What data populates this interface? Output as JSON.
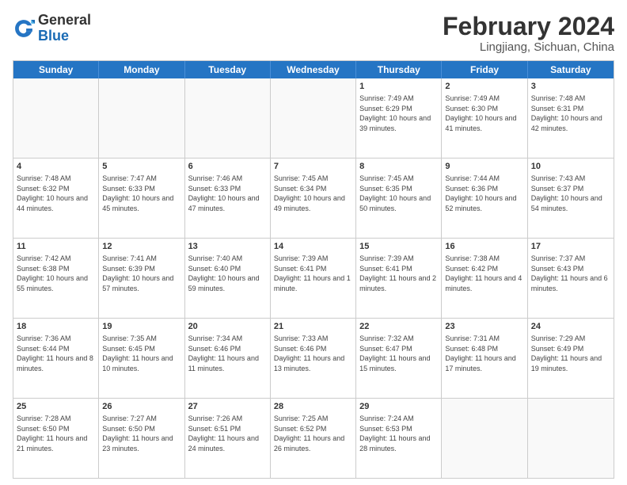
{
  "header": {
    "logo_general": "General",
    "logo_blue": "Blue",
    "month_title": "February 2024",
    "location": "Lingjiang, Sichuan, China"
  },
  "days_of_week": [
    "Sunday",
    "Monday",
    "Tuesday",
    "Wednesday",
    "Thursday",
    "Friday",
    "Saturday"
  ],
  "rows": [
    [
      {
        "day": "",
        "info": ""
      },
      {
        "day": "",
        "info": ""
      },
      {
        "day": "",
        "info": ""
      },
      {
        "day": "",
        "info": ""
      },
      {
        "day": "1",
        "info": "Sunrise: 7:49 AM\nSunset: 6:29 PM\nDaylight: 10 hours and 39 minutes."
      },
      {
        "day": "2",
        "info": "Sunrise: 7:49 AM\nSunset: 6:30 PM\nDaylight: 10 hours and 41 minutes."
      },
      {
        "day": "3",
        "info": "Sunrise: 7:48 AM\nSunset: 6:31 PM\nDaylight: 10 hours and 42 minutes."
      }
    ],
    [
      {
        "day": "4",
        "info": "Sunrise: 7:48 AM\nSunset: 6:32 PM\nDaylight: 10 hours and 44 minutes."
      },
      {
        "day": "5",
        "info": "Sunrise: 7:47 AM\nSunset: 6:33 PM\nDaylight: 10 hours and 45 minutes."
      },
      {
        "day": "6",
        "info": "Sunrise: 7:46 AM\nSunset: 6:33 PM\nDaylight: 10 hours and 47 minutes."
      },
      {
        "day": "7",
        "info": "Sunrise: 7:45 AM\nSunset: 6:34 PM\nDaylight: 10 hours and 49 minutes."
      },
      {
        "day": "8",
        "info": "Sunrise: 7:45 AM\nSunset: 6:35 PM\nDaylight: 10 hours and 50 minutes."
      },
      {
        "day": "9",
        "info": "Sunrise: 7:44 AM\nSunset: 6:36 PM\nDaylight: 10 hours and 52 minutes."
      },
      {
        "day": "10",
        "info": "Sunrise: 7:43 AM\nSunset: 6:37 PM\nDaylight: 10 hours and 54 minutes."
      }
    ],
    [
      {
        "day": "11",
        "info": "Sunrise: 7:42 AM\nSunset: 6:38 PM\nDaylight: 10 hours and 55 minutes."
      },
      {
        "day": "12",
        "info": "Sunrise: 7:41 AM\nSunset: 6:39 PM\nDaylight: 10 hours and 57 minutes."
      },
      {
        "day": "13",
        "info": "Sunrise: 7:40 AM\nSunset: 6:40 PM\nDaylight: 10 hours and 59 minutes."
      },
      {
        "day": "14",
        "info": "Sunrise: 7:39 AM\nSunset: 6:41 PM\nDaylight: 11 hours and 1 minute."
      },
      {
        "day": "15",
        "info": "Sunrise: 7:39 AM\nSunset: 6:41 PM\nDaylight: 11 hours and 2 minutes."
      },
      {
        "day": "16",
        "info": "Sunrise: 7:38 AM\nSunset: 6:42 PM\nDaylight: 11 hours and 4 minutes."
      },
      {
        "day": "17",
        "info": "Sunrise: 7:37 AM\nSunset: 6:43 PM\nDaylight: 11 hours and 6 minutes."
      }
    ],
    [
      {
        "day": "18",
        "info": "Sunrise: 7:36 AM\nSunset: 6:44 PM\nDaylight: 11 hours and 8 minutes."
      },
      {
        "day": "19",
        "info": "Sunrise: 7:35 AM\nSunset: 6:45 PM\nDaylight: 11 hours and 10 minutes."
      },
      {
        "day": "20",
        "info": "Sunrise: 7:34 AM\nSunset: 6:46 PM\nDaylight: 11 hours and 11 minutes."
      },
      {
        "day": "21",
        "info": "Sunrise: 7:33 AM\nSunset: 6:46 PM\nDaylight: 11 hours and 13 minutes."
      },
      {
        "day": "22",
        "info": "Sunrise: 7:32 AM\nSunset: 6:47 PM\nDaylight: 11 hours and 15 minutes."
      },
      {
        "day": "23",
        "info": "Sunrise: 7:31 AM\nSunset: 6:48 PM\nDaylight: 11 hours and 17 minutes."
      },
      {
        "day": "24",
        "info": "Sunrise: 7:29 AM\nSunset: 6:49 PM\nDaylight: 11 hours and 19 minutes."
      }
    ],
    [
      {
        "day": "25",
        "info": "Sunrise: 7:28 AM\nSunset: 6:50 PM\nDaylight: 11 hours and 21 minutes."
      },
      {
        "day": "26",
        "info": "Sunrise: 7:27 AM\nSunset: 6:50 PM\nDaylight: 11 hours and 23 minutes."
      },
      {
        "day": "27",
        "info": "Sunrise: 7:26 AM\nSunset: 6:51 PM\nDaylight: 11 hours and 24 minutes."
      },
      {
        "day": "28",
        "info": "Sunrise: 7:25 AM\nSunset: 6:52 PM\nDaylight: 11 hours and 26 minutes."
      },
      {
        "day": "29",
        "info": "Sunrise: 7:24 AM\nSunset: 6:53 PM\nDaylight: 11 hours and 28 minutes."
      },
      {
        "day": "",
        "info": ""
      },
      {
        "day": "",
        "info": ""
      }
    ]
  ]
}
